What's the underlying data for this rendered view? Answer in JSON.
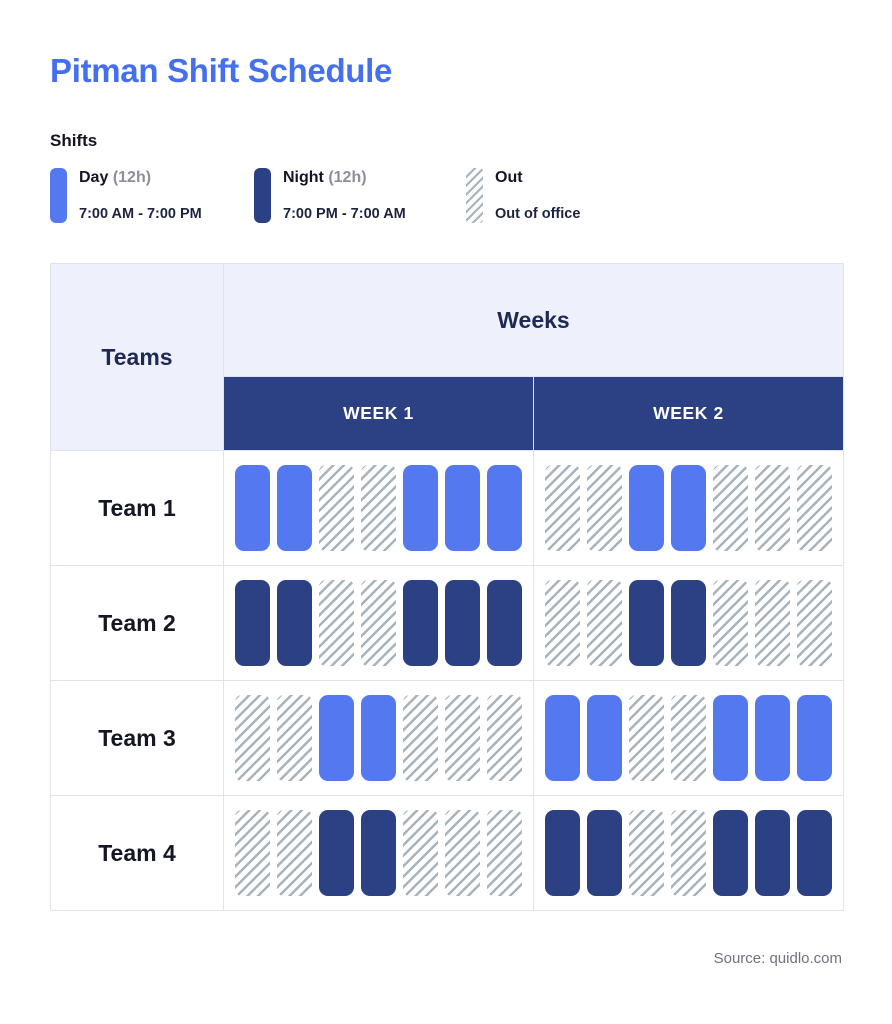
{
  "header": {
    "title": "Pitman Shift Schedule"
  },
  "legend": {
    "heading": "Shifts",
    "items": [
      {
        "key": "day",
        "swatch": "day-color-swatch",
        "label": "Day",
        "duration": "(12h)",
        "hours": "7:00 AM - 7:00 PM",
        "color": "#5478f0"
      },
      {
        "key": "night",
        "swatch": "night-color-swatch",
        "label": "Night",
        "duration": "(12h)",
        "hours": "7:00 PM - 7:00 AM",
        "color": "#2c4183"
      },
      {
        "key": "out",
        "swatch": "out-hatched-swatch",
        "label": "Out",
        "duration": "",
        "hours": "Out of office",
        "color": "#a8b4bd"
      }
    ]
  },
  "table": {
    "teams_header": "Teams",
    "weeks_header": "Weeks",
    "week_columns": [
      "WEEK 1",
      "WEEK 2"
    ]
  },
  "footer": {
    "source": "Source: quidlo.com"
  },
  "colors": {
    "accent": "#4470ef",
    "day": "#5478f0",
    "night": "#2c4183",
    "header_bg": "#eef1fb",
    "week_band_bg": "#2c4183",
    "border": "#dfe3ef",
    "out_stripe": "#a8b4bd"
  },
  "chart_data": {
    "type": "table",
    "title": "Pitman Shift Schedule",
    "xlabel": "Weeks",
    "ylabel": "Teams",
    "categories": [
      "WEEK 1",
      "WEEK 2"
    ],
    "days_per_week": 7,
    "legend": [
      "Day (12h) 7:00 AM - 7:00 PM",
      "Night (12h) 7:00 PM - 7:00 AM",
      "Out — Out of office"
    ],
    "rows": [
      {
        "team": "Team 1",
        "weeks": [
          {
            "label": "WEEK 1",
            "shifts": [
              "day",
              "day",
              "out",
              "out",
              "day",
              "day",
              "day"
            ]
          },
          {
            "label": "WEEK 2",
            "shifts": [
              "out",
              "out",
              "day",
              "day",
              "out",
              "out",
              "out"
            ]
          }
        ]
      },
      {
        "team": "Team 2",
        "weeks": [
          {
            "label": "WEEK 1",
            "shifts": [
              "night",
              "night",
              "out",
              "out",
              "night",
              "night",
              "night"
            ]
          },
          {
            "label": "WEEK 2",
            "shifts": [
              "out",
              "out",
              "night",
              "night",
              "out",
              "out",
              "out"
            ]
          }
        ]
      },
      {
        "team": "Team 3",
        "weeks": [
          {
            "label": "WEEK 1",
            "shifts": [
              "out",
              "out",
              "day",
              "day",
              "out",
              "out",
              "out"
            ]
          },
          {
            "label": "WEEK 2",
            "shifts": [
              "day",
              "day",
              "out",
              "out",
              "day",
              "day",
              "day"
            ]
          }
        ]
      },
      {
        "team": "Team 4",
        "weeks": [
          {
            "label": "WEEK 1",
            "shifts": [
              "out",
              "out",
              "night",
              "night",
              "out",
              "out",
              "out"
            ]
          },
          {
            "label": "WEEK 2",
            "shifts": [
              "night",
              "night",
              "out",
              "out",
              "night",
              "night",
              "night"
            ]
          }
        ]
      }
    ],
    "source": "Source: quidlo.com"
  }
}
